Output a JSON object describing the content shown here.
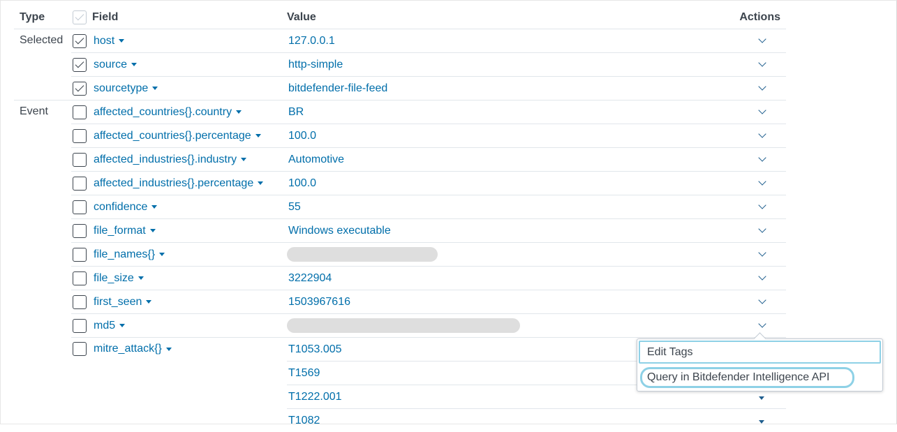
{
  "headers": {
    "type": "Type",
    "field": "Field",
    "value": "Value",
    "actions": "Actions"
  },
  "rows": [
    {
      "type": "Selected",
      "field": "host",
      "value": "127.0.0.1",
      "checked": true
    },
    {
      "type": "",
      "field": "source",
      "value": "http-simple",
      "checked": true
    },
    {
      "type": "",
      "field": "sourcetype",
      "value": "bitdefender-file-feed",
      "checked": true
    },
    {
      "type": "Event",
      "field": "affected_countries{}.country",
      "value": "BR",
      "checked": false
    },
    {
      "type": "",
      "field": "affected_countries{}.percentage",
      "value": "100.0",
      "checked": false
    },
    {
      "type": "",
      "field": "affected_industries{}.industry",
      "value": "Automotive",
      "checked": false
    },
    {
      "type": "",
      "field": "affected_industries{}.percentage",
      "value": "100.0",
      "checked": false
    },
    {
      "type": "",
      "field": "confidence",
      "value": "55",
      "checked": false
    },
    {
      "type": "",
      "field": "file_format",
      "value": "Windows executable",
      "checked": false
    },
    {
      "type": "",
      "field": "file_names{}",
      "value": "",
      "redacted": true,
      "checked": false
    },
    {
      "type": "",
      "field": "file_size",
      "value": "3222904",
      "checked": false
    },
    {
      "type": "",
      "field": "first_seen",
      "value": "1503967616",
      "checked": false
    },
    {
      "type": "",
      "field": "md5",
      "value": "",
      "redacted": true,
      "checked": false
    },
    {
      "type": "",
      "field": "mitre_attack{}",
      "value": "T1053.005",
      "checked": false
    }
  ],
  "extra_values": [
    "T1569",
    "T1222.001",
    "T1082"
  ],
  "dropdown": {
    "items": [
      "Edit Tags",
      "Query in Bitdefender Intelligence API"
    ]
  }
}
